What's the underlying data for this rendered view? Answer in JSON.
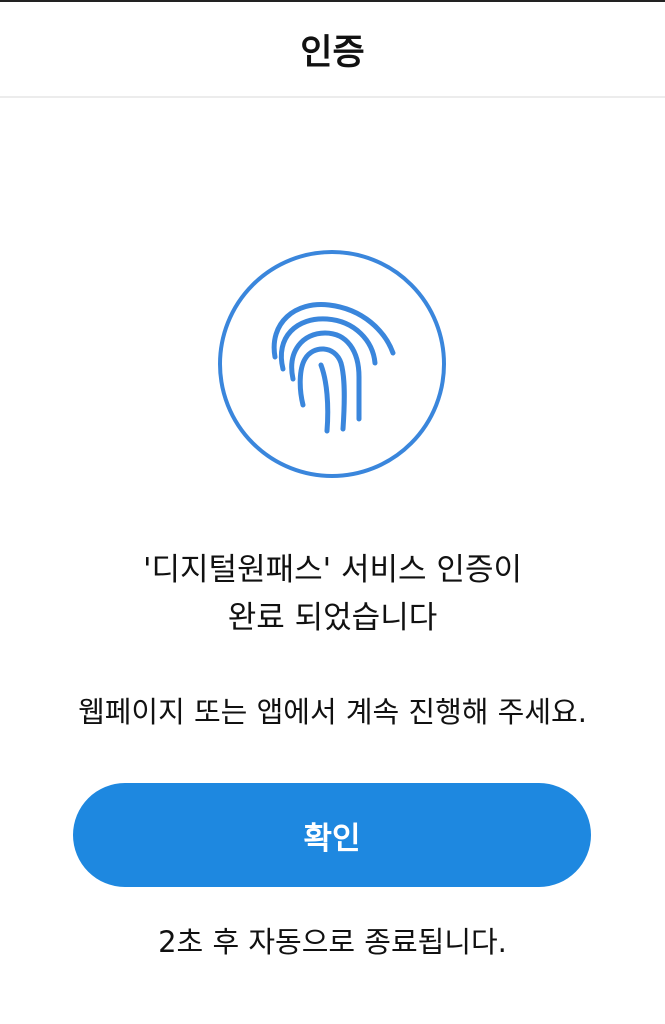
{
  "header": {
    "title": "인증"
  },
  "icon": {
    "name": "fingerprint-icon",
    "color": "#3a86dc"
  },
  "message": {
    "line1": "'디지털원패스' 서비스 인증이",
    "line2": "완료 되었습니다"
  },
  "subtext": "웹페이지 또는 앱에서 계속 진행해 주세요.",
  "confirm_button": {
    "label": "확인",
    "color": "#1e88e0"
  },
  "footer_note": "2초 후 자동으로 종료됩니다."
}
